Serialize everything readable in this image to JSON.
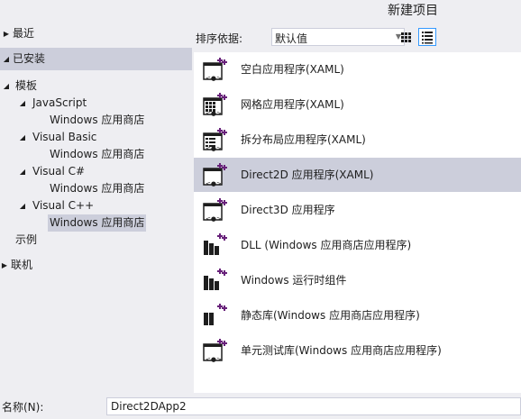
{
  "window": {
    "title": "新建项目"
  },
  "tree": {
    "recent": "最近",
    "installed": "已安装",
    "templates": "模板",
    "javascript": "JavaScript",
    "js_store": "Windows 应用商店",
    "vb": "Visual Basic",
    "vb_store": "Windows 应用商店",
    "cs": "Visual C#",
    "cs_store": "Windows 应用商店",
    "cpp": "Visual C++",
    "cpp_store": "Windows 应用商店",
    "samples": "示例",
    "online": "联机"
  },
  "sort": {
    "label": "排序依据:",
    "value": "默认值"
  },
  "templates": [
    {
      "label": "空白应用程序(XAML)",
      "icon": "blank-app-icon"
    },
    {
      "label": "网格应用程序(XAML)",
      "icon": "grid-app-icon"
    },
    {
      "label": "拆分布局应用程序(XAML)",
      "icon": "split-app-icon"
    },
    {
      "label": "Direct2D 应用程序(XAML)",
      "icon": "direct2d-app-icon",
      "selected": true
    },
    {
      "label": "Direct3D 应用程序",
      "icon": "direct3d-app-icon"
    },
    {
      "label": "DLL (Windows 应用商店应用程序)",
      "icon": "dll-icon"
    },
    {
      "label": "Windows 运行时组件",
      "icon": "winrt-component-icon"
    },
    {
      "label": "静态库(Windows 应用商店应用程序)",
      "icon": "static-lib-icon"
    },
    {
      "label": "单元测试库(Windows 应用商店应用程序)",
      "icon": "unit-test-icon"
    }
  ],
  "name_field": {
    "label": "名称(N):",
    "value": "Direct2DApp2"
  },
  "colors": {
    "background": "#EEEEF2",
    "selection": "#CCCEDB",
    "accent": "#68217A",
    "active_border": "#3399FF"
  }
}
